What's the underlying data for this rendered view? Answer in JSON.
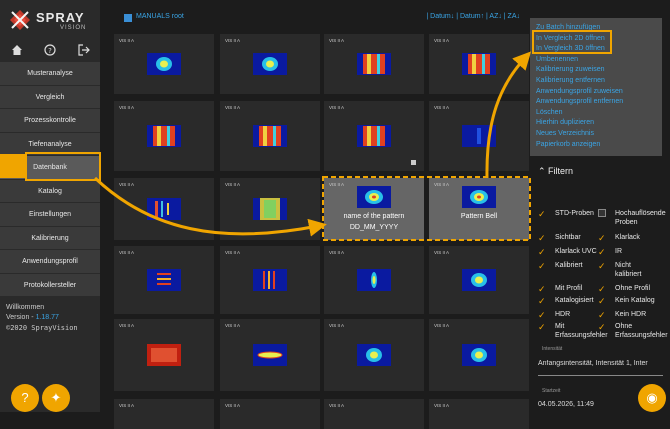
{
  "app": {
    "logo_line1": "SPRAY",
    "logo_line2": "VISION"
  },
  "sidebar": {
    "items": [
      {
        "label": "Musteranalyse"
      },
      {
        "label": "Vergleich"
      },
      {
        "label": "Prozesskontrolle"
      },
      {
        "label": "Tiefenanalyse"
      },
      {
        "label": "Datenbank"
      },
      {
        "label": "Katalog"
      },
      {
        "label": "Einstellungen"
      },
      {
        "label": "Kalibrierung"
      },
      {
        "label": "Anwendungsprofil"
      },
      {
        "label": "Protokollersteller"
      }
    ],
    "welcome": "Willkommen",
    "version_label": "Version - ",
    "version": "1.18.77",
    "copyright": "©2020 SprayVision"
  },
  "header": {
    "breadcrumb": "MANUALS root",
    "sort": "| Datum↓ | Datum↑ | AZ↓ | ZA↓"
  },
  "grid": {
    "tile_label": "VIS II A",
    "highlighted": [
      {
        "name_line1": "name of the pattern",
        "name_line2": "DD_MM_YYYY"
      },
      {
        "name_line1": "Pattern Bell",
        "name_line2": ""
      }
    ]
  },
  "context_menu": {
    "items": [
      "Zu Batch hinzufügen",
      "In Vergleich 2D öffnen",
      "In Vergleich 3D öffnen",
      "Umbenennen",
      "Kalibrierung zuweisen",
      "Kalibrierung entfernen",
      "Anwendungsprofil zuweisen",
      "Anwendungsprofil entfernen",
      "Löschen",
      "Hierhin duplizieren",
      "Neues Verzeichnis",
      "Papierkorb anzeigen"
    ]
  },
  "filters": {
    "heading": "Filtern",
    "left": [
      {
        "label": "STD-Proben",
        "checked": true
      },
      {
        "label": "Sichtbar",
        "checked": true
      },
      {
        "label": "Klarlack UVC",
        "checked": true
      },
      {
        "label": "Kalibriert",
        "checked": true
      },
      {
        "label": "Mit Profil",
        "checked": true
      },
      {
        "label": "Katalogisiert",
        "checked": true
      },
      {
        "label": "HDR",
        "checked": true
      },
      {
        "label": "Mit",
        "label2": "Erfassungsfehler",
        "checked": true
      }
    ],
    "right": [
      {
        "label": "Hochauflösende",
        "label2": "Proben",
        "checked": false
      },
      {
        "label": "Klarlack",
        "checked": true
      },
      {
        "label": "IR",
        "checked": true
      },
      {
        "label": "Nicht",
        "label2": "kalibriert",
        "checked": true
      },
      {
        "label": "Ohne Profil",
        "checked": true
      },
      {
        "label": "Kein Katalog",
        "checked": true
      },
      {
        "label": "Kein HDR",
        "checked": true
      },
      {
        "label": "Ohne",
        "label2": "Erfassungsfehler",
        "checked": true
      }
    ],
    "intensity_label": "Intensität",
    "intensity_value": "Anfangsintensität, Intensität 1, Inter",
    "start_label": "Startzeit",
    "start_value": "04.05.2026, 11:49"
  },
  "colors": {
    "accent": "#f0a500",
    "link": "#3aa5e6"
  }
}
